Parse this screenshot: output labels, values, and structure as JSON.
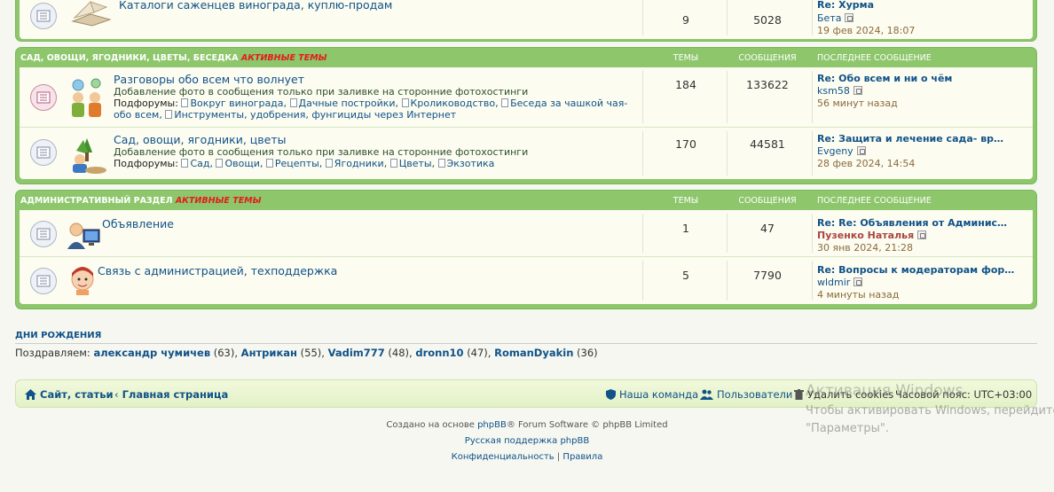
{
  "block0": {
    "row": {
      "title": "Каталоги саженцев винограда, куплю-продам",
      "topics": "9",
      "posts": "5028",
      "last_title": "Re: Хурма",
      "last_user": "Бета",
      "last_time": "19 фев 2024, 18:07"
    }
  },
  "block1": {
    "category": "Сад, овощи, ягодники, цветы, беседка",
    "active_link": "Активные темы",
    "h_topics": "Темы",
    "h_posts": "Сообщения",
    "h_last": "Последнее сообщение",
    "rows": [
      {
        "title": "Разговоры обо всем что волнует",
        "desc": "Добавление фото в сообщения только при заливке на сторонние фотохостинги",
        "subs_label": "Подфорумы:",
        "subs": [
          "Вокруг винограда,",
          "Дачные постройки,",
          "Кролиководство,",
          "Беседа за чашкой чая-",
          "обо всем,",
          "Инструменты, удобрения, фунгициды через Интернет"
        ],
        "topics": "184",
        "posts": "133622",
        "last_title": "Re: Обо всем и ни о чём",
        "last_user": "ksm58",
        "last_time": "56 минут назад"
      },
      {
        "title": "Сад, овощи, ягодники, цветы",
        "desc": "Добавление фото в сообщения только при заливке на сторонние фотохостинги",
        "subs_label": "Подфорумы:",
        "subs": [
          "Сад,",
          "Овощи,",
          "Рецепты,",
          "Ягодники,",
          "Цветы,",
          "Экзотика"
        ],
        "topics": "170",
        "posts": "44581",
        "last_title": "Re: Защита и лечение сада- вр…",
        "last_user": "Evgeny",
        "last_time": "28 фев 2024, 14:54"
      }
    ]
  },
  "block2": {
    "category": "Административный раздел",
    "active_link": "Активные темы",
    "h_topics": "Темы",
    "h_posts": "Сообщения",
    "h_last": "Последнее сообщение",
    "rows": [
      {
        "title": "Объявление",
        "topics": "1",
        "posts": "47",
        "last_title": "Re: Re: Объявления от Админис…",
        "last_user": "Пузенко Наталья",
        "last_time": "30 янв 2024, 21:28"
      },
      {
        "title": "Связь с администрацией, техподдержка",
        "topics": "5",
        "posts": "7790",
        "last_title": "Re: Вопросы к модераторам фор…",
        "last_user": "wldmir",
        "last_time": "4 минуты назад"
      }
    ]
  },
  "birthdays": {
    "title": "Дни рождения",
    "prefix": "Поздравляем:",
    "people": [
      {
        "name": "александр чумичев",
        "age": "(63),"
      },
      {
        "name": "Антрикан",
        "age": "(55),"
      },
      {
        "name": "Vadim777",
        "age": "(48),"
      },
      {
        "name": "dronn10",
        "age": "(47),"
      },
      {
        "name": "RomanDyakin",
        "age": "(36)"
      }
    ]
  },
  "navbar": {
    "site": "Сайт, статьи",
    "home": "Главная страница",
    "team": "Наша команда",
    "users": "Пользователи",
    "delete_cookies": "Удалить cookies",
    "timezone": "Часовой пояс: UTC+03:00"
  },
  "credits": {
    "line1_a": "Создано на основе",
    "line1_link": "phpBB",
    "line1_b": "® Forum Software © phpBB Limited",
    "line2": "Русская поддержка phpBB",
    "privacy": "Конфиденциальность",
    "sep": "|",
    "rules": "Правила"
  },
  "watermark": {
    "line1": "Активация Windows",
    "line2": "Чтобы активировать Windows, перейдите",
    "line3": "\"Параметры\"."
  },
  "colors": {
    "header_green": "#8dc66b",
    "row_bg": "#fcfcf0",
    "link": "#105289",
    "active_red": "#e41c1c"
  }
}
